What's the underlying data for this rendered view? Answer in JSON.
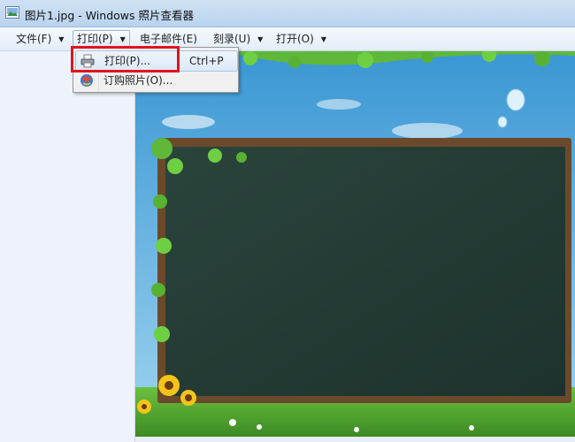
{
  "window": {
    "title": "图片1.jpg - Windows 照片查看器"
  },
  "menubar": {
    "items": [
      {
        "label": "文件(F)",
        "has_caret": true
      },
      {
        "label": "打印(P)",
        "has_caret": true
      },
      {
        "label": "电子邮件(E)",
        "has_caret": false
      },
      {
        "label": "刻录(U)",
        "has_caret": true
      },
      {
        "label": "打开(O)",
        "has_caret": true
      }
    ]
  },
  "print_menu": {
    "items": [
      {
        "label": "打印(P)...",
        "shortcut": "Ctrl+P",
        "icon": "printer-icon"
      },
      {
        "label": "订购照片(O)...",
        "shortcut": "",
        "icon": "order-prints-icon"
      }
    ]
  },
  "photo": {
    "description_colors": {
      "sky": "#4fa8d8",
      "chalkboard": "#223a33",
      "frame": "#6b4a2b",
      "grass": "#4e9a2f"
    }
  },
  "colors": {
    "highlight": "#e0141e"
  }
}
